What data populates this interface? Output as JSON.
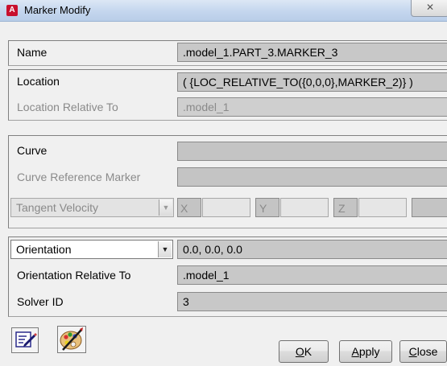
{
  "window": {
    "title": "Marker Modify",
    "app_icon_letter": "A",
    "close_glyph": "✕"
  },
  "fields": {
    "name": {
      "label": "Name",
      "value": ".model_1.PART_3.MARKER_3"
    },
    "location": {
      "label": "Location",
      "value": "( {LOC_RELATIVE_TO({0,0,0},MARKER_2)} )"
    },
    "location_relative_to": {
      "label": "Location Relative To",
      "value": ".model_1"
    },
    "curve": {
      "label": "Curve",
      "value": ""
    },
    "curve_reference_marker": {
      "label": "Curve Reference Marker",
      "value": ""
    },
    "tangent_velocity": {
      "selected": "Tangent Velocity",
      "x_label": "X",
      "y_label": "Y",
      "z_label": "Z"
    },
    "orientation": {
      "selected": "Orientation",
      "value": "0.0, 0.0, 0.0"
    },
    "orientation_relative_to": {
      "label": "Orientation Relative To",
      "value": ".model_1"
    },
    "solver_id": {
      "label": "Solver ID",
      "value": "3"
    }
  },
  "buttons": {
    "ok_letter": "O",
    "ok_rest": "K",
    "apply_letter": "A",
    "apply_rest": "pply",
    "close_letter": "C",
    "close_rest": "lose"
  },
  "toolbar": {
    "icons": [
      "edit-notes-icon",
      "appearance-palette-icon"
    ]
  },
  "colors": {
    "field_bg": "#c8c8c8",
    "title_gradient_top": "#dce7f5",
    "app_icon_red": "#c8102e"
  }
}
